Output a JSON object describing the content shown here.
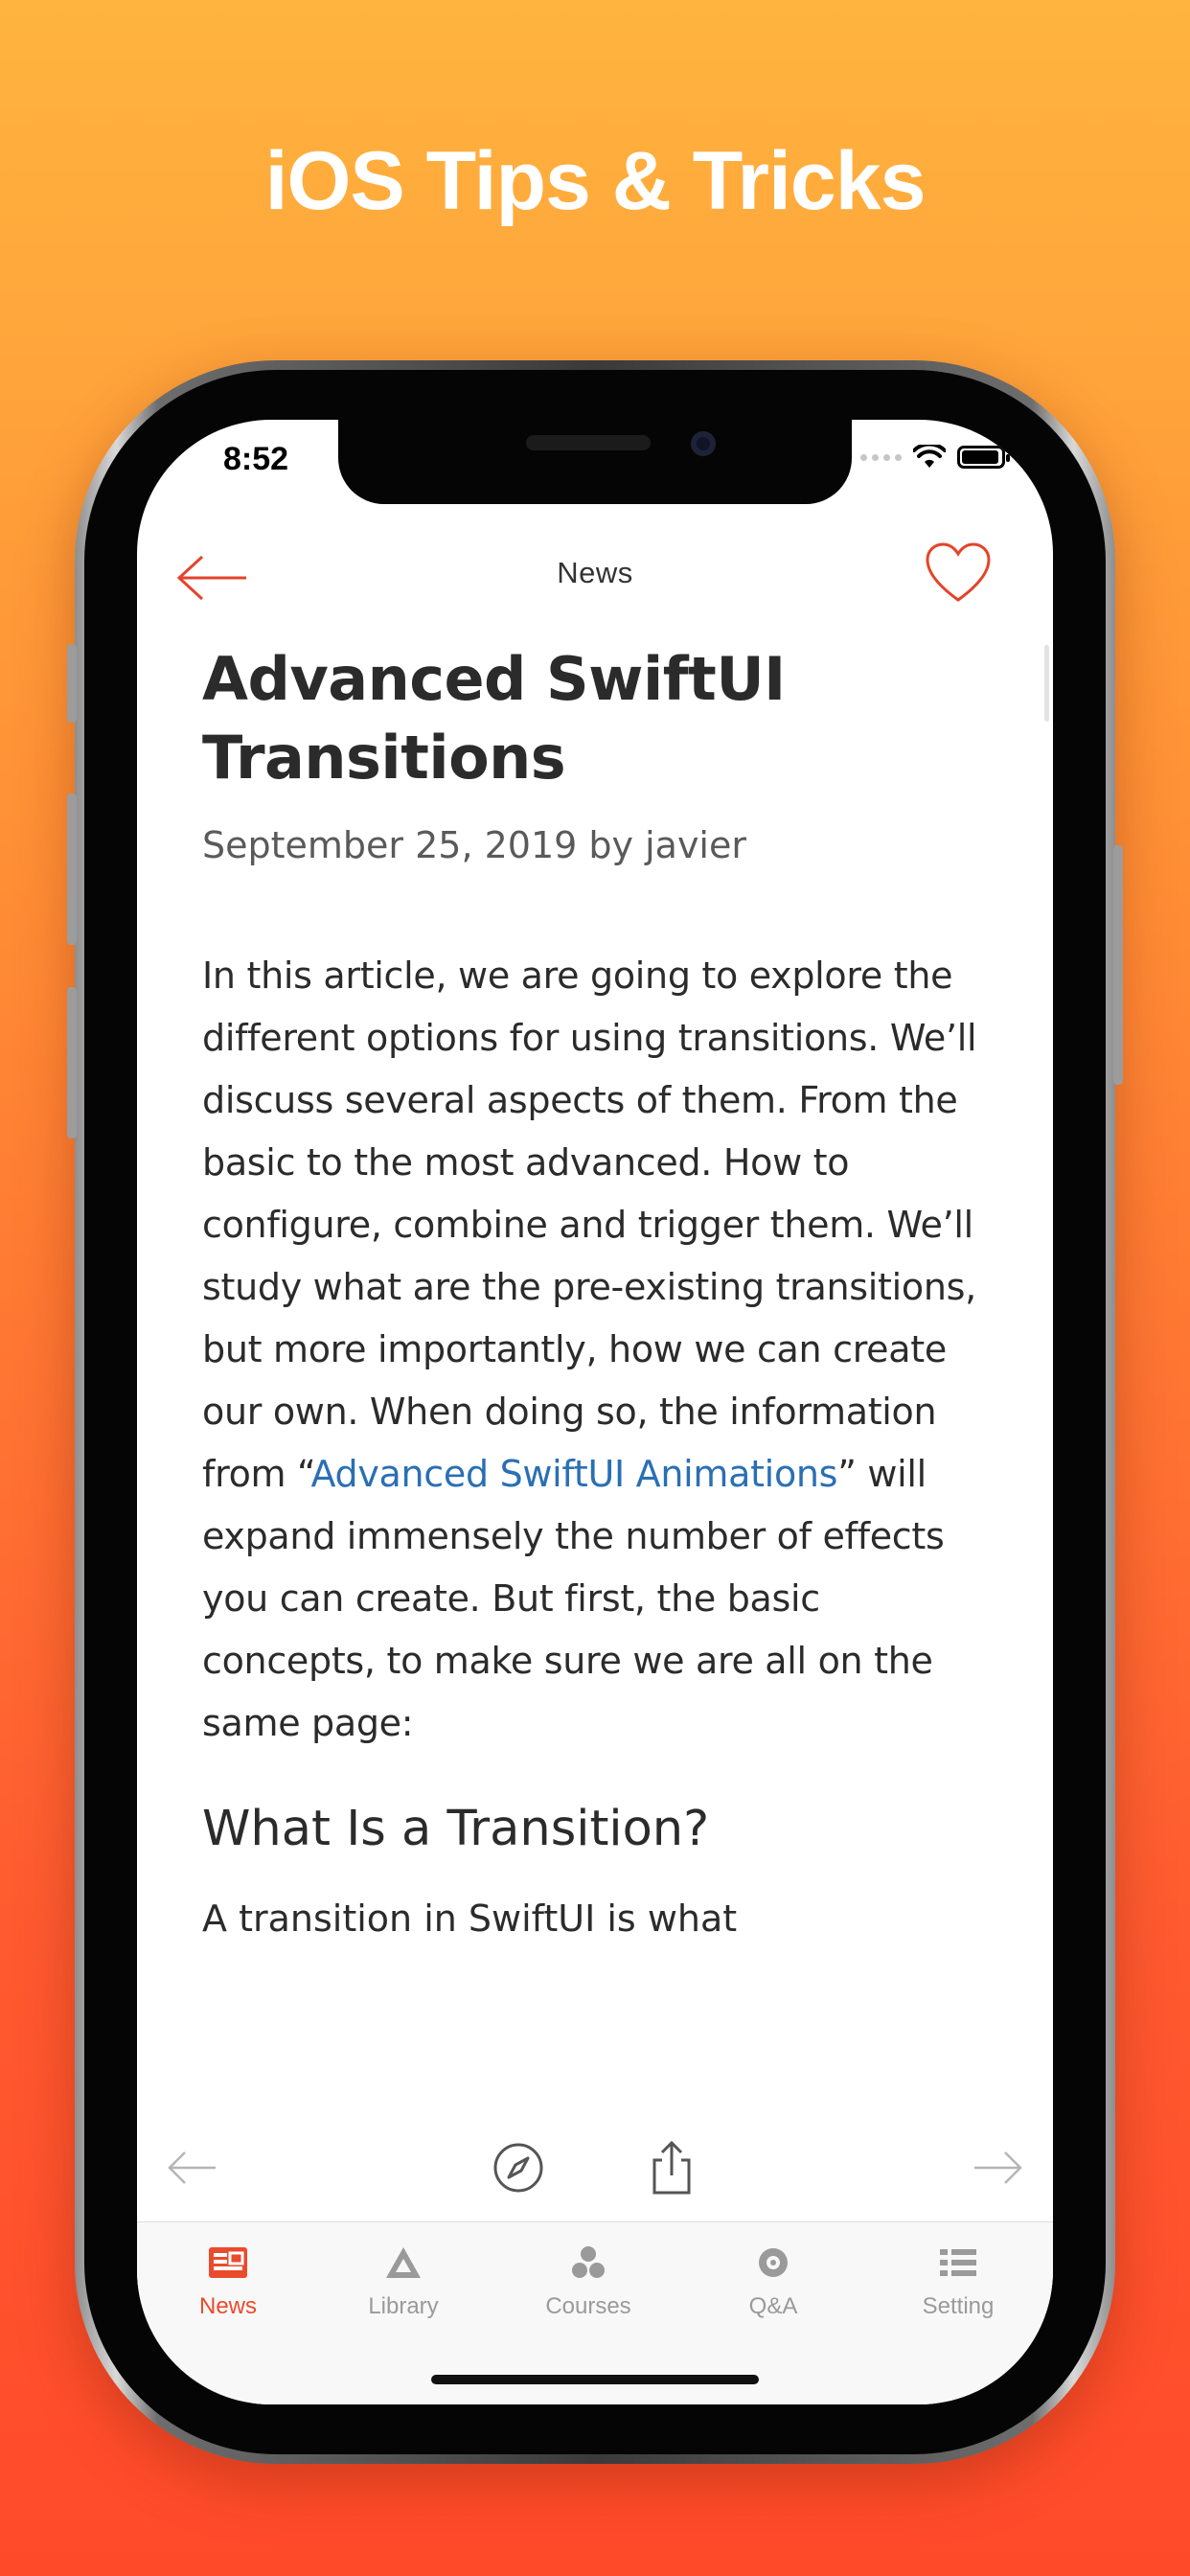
{
  "headline": "iOS Tips & Tricks",
  "status_bar": {
    "time": "8:52"
  },
  "nav": {
    "title": "News",
    "back_icon": "arrow-left-icon",
    "favorite_icon": "heart-icon"
  },
  "article": {
    "title": "Advanced SwiftUI Transitions",
    "meta": "September 25, 2019 by javier",
    "body_before_link": "In this article, we are going to explore the different options for using transitions. We’ll discuss several aspects of them. From the basic to the most advanced. How to configure, combine and trigger them. We’ll study what are the pre-existing transitions, but more importantly, how we can create our own. When doing so, the information from “",
    "link_text": "Advanced SwiftUI Animations",
    "body_after_link": "” will expand immensely the number of effects you can create. But first, the basic concepts, to make sure we are all on the same page:",
    "section_heading": "What Is a Transition?",
    "section_text": "A transition in SwiftUI is what"
  },
  "toolbar": {
    "items": [
      "back-arrow-icon",
      "compass-icon",
      "share-icon",
      "forward-arrow-icon"
    ]
  },
  "tabbar": {
    "items": [
      {
        "label": "News",
        "icon": "news-icon",
        "active": true
      },
      {
        "label": "Library",
        "icon": "library-icon",
        "active": false
      },
      {
        "label": "Courses",
        "icon": "courses-icon",
        "active": false
      },
      {
        "label": "Q&A",
        "icon": "qa-icon",
        "active": false
      },
      {
        "label": "Setting",
        "icon": "settings-icon",
        "active": false
      }
    ]
  },
  "colors": {
    "accent": "#ea4b2c",
    "link": "#2a6fb4",
    "gradient_top": "#ffb43f",
    "gradient_bottom": "#ff4a2a"
  }
}
